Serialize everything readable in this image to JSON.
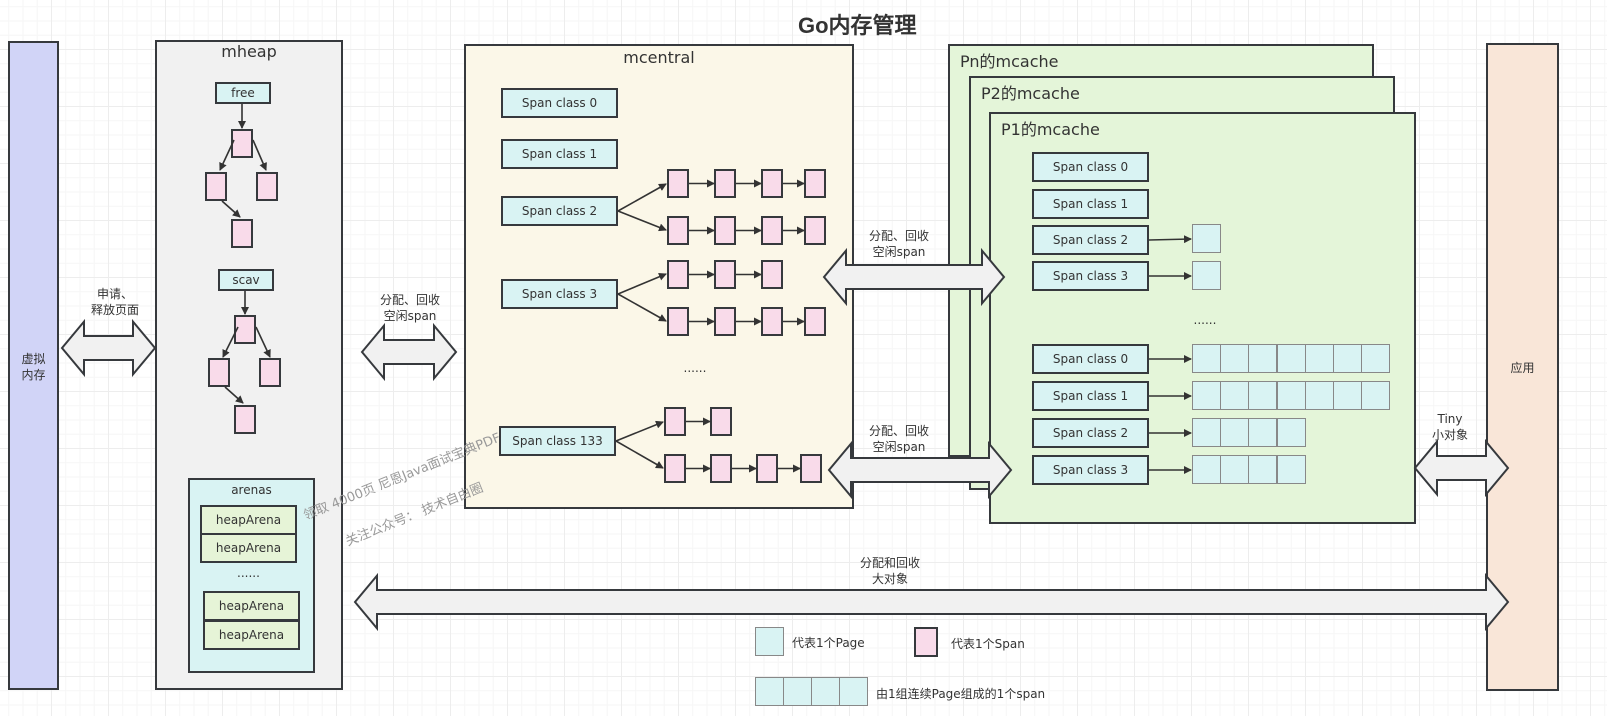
{
  "title": "Go内存管理",
  "virtual_memory": {
    "label": "虚拟\n内存",
    "color": "#d1d4f7"
  },
  "application": {
    "label": "应用",
    "color": "#f9e6d8"
  },
  "mheap": {
    "label": "mheap",
    "free_label": "free",
    "scav_label": "scav",
    "arenas": {
      "label": "arenas",
      "items": [
        "heapArena",
        "heapArena",
        "heapArena",
        "heapArena"
      ],
      "ellipsis": "......"
    }
  },
  "mcentral": {
    "label": "mcentral",
    "span_classes": [
      "Span class 0",
      "Span class 1",
      "Span class 2",
      "Span class 3",
      "Span class 133"
    ],
    "ellipsis": "......"
  },
  "mcache": {
    "pn_label": "Pn的mcache",
    "p2_label": "P2的mcache",
    "p1_label": "P1的mcache",
    "span_classes_top": [
      "Span class 0",
      "Span class 1",
      "Span class 2",
      "Span class 3"
    ],
    "span_classes_bottom": [
      "Span class 0",
      "Span class 1",
      "Span class 2",
      "Span class 3"
    ],
    "bottom_page_counts": [
      7,
      7,
      4,
      4
    ],
    "ellipsis": "......"
  },
  "arrows": {
    "vm_mheap": "申请、\n释放页面",
    "mheap_mcentral": "分配、回收\n空闲span",
    "mcentral_mcache_top": "分配、回收\n空闲span",
    "mcentral_mcache_bottom": "分配、回收\n空闲span",
    "tiny": "Tiny\n小对象",
    "large": "分配和回收\n大对象"
  },
  "legend": {
    "page": "代表1个Page",
    "span": "代表1个Span",
    "span_of_pages": "由1组连续Page组成的1个span"
  },
  "watermark": {
    "line1": "领取 4000页 尼恩Java面试宝典PDF",
    "line2": "关注公众号：  技术自由圈"
  }
}
